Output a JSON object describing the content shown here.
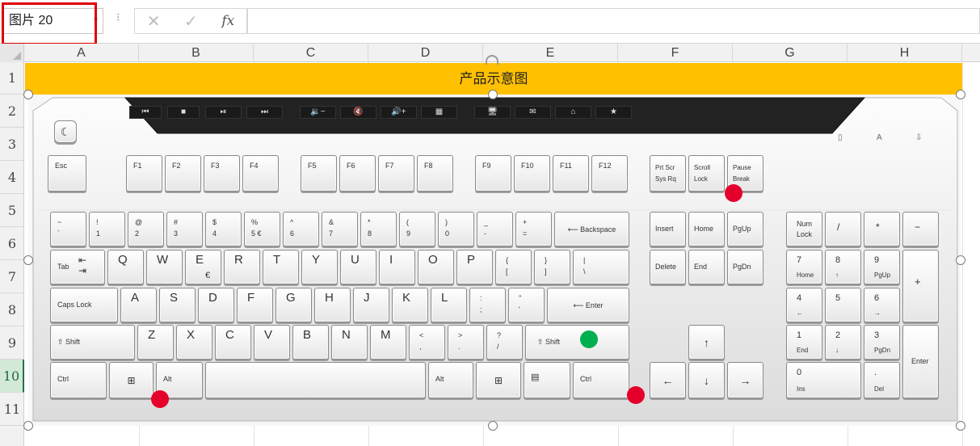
{
  "formula_bar": {
    "name_box": "图片 20",
    "name_box_dropdown": "▾",
    "separator": "⁝",
    "cancel_icon": "✕",
    "enter_icon": "✓",
    "fx": "fx",
    "formula": ""
  },
  "columns": [
    "A",
    "B",
    "C",
    "D",
    "E",
    "F",
    "G",
    "H"
  ],
  "rows": [
    "1",
    "2",
    "3",
    "4",
    "5",
    "6",
    "7",
    "8",
    "9",
    "10",
    "11"
  ],
  "selected_row": "10",
  "title_cell": "产品示意图",
  "picture": {
    "name": "keyboard-photo",
    "media_labels": [
      "⏮",
      "■",
      "⏯",
      "⏭",
      "🔉−",
      "🔇",
      "🔊+",
      "▦",
      "🖥",
      "✉",
      "⌂",
      "★"
    ],
    "function_row": [
      "Esc",
      "F1",
      "F2",
      "F3",
      "F4",
      "F5",
      "F6",
      "F7",
      "F8",
      "F9",
      "F10",
      "F11",
      "F12"
    ],
    "system_keys": [
      [
        "Prt Scr",
        "Sys Rq"
      ],
      [
        "Scroll",
        "Lock"
      ],
      [
        "Pause",
        "Break"
      ]
    ],
    "number_row": [
      [
        "~",
        "`"
      ],
      [
        "!",
        "1"
      ],
      [
        "@",
        "2"
      ],
      [
        "#",
        "3"
      ],
      [
        "$",
        "4"
      ],
      [
        "%",
        "5 €"
      ],
      [
        "^",
        "6"
      ],
      [
        "&",
        "7"
      ],
      [
        "*",
        "8"
      ],
      [
        "(",
        "9"
      ],
      [
        ")",
        "0"
      ],
      [
        "_",
        "-"
      ],
      [
        "+",
        "="
      ]
    ],
    "backspace": "⟵ Backspace",
    "tab": "Tab",
    "qwerty": [
      "Q",
      "W",
      "E",
      "R",
      "T",
      "Y",
      "U",
      "I",
      "O",
      "P"
    ],
    "brackets": [
      [
        "{",
        "["
      ],
      [
        "}",
        "]"
      ],
      [
        "|",
        "\\"
      ]
    ],
    "capslock": "Caps Lock",
    "asdf": [
      "A",
      "S",
      "D",
      "F",
      "G",
      "H",
      "J",
      "K",
      "L"
    ],
    "semis": [
      [
        ":",
        ";"
      ],
      [
        "\"",
        "'"
      ]
    ],
    "enter": "⟵ Enter",
    "shift": "⇧ Shift",
    "zxcv": [
      "Z",
      "X",
      "C",
      "V",
      "B",
      "N",
      "M"
    ],
    "punct": [
      [
        "<",
        ","
      ],
      [
        ">",
        "."
      ],
      [
        "?",
        "/"
      ]
    ],
    "ctrl": "Ctrl",
    "alt": "Alt",
    "nav_top": [
      "Insert",
      "Home",
      "PgUp"
    ],
    "nav_bottom": [
      "Delete",
      "End",
      "PgDn"
    ],
    "arrows": [
      "↑",
      "←",
      "↓",
      "→"
    ],
    "numlock": [
      "Num",
      "Lock"
    ],
    "numpad": {
      "div": "/",
      "mul": "*",
      "minus": "−",
      "plus": "+",
      "enter": "Enter",
      "keys": [
        [
          "7",
          "Home"
        ],
        [
          "8",
          "↑"
        ],
        [
          "9",
          "PgUp"
        ],
        [
          "4",
          "←"
        ],
        [
          "5",
          ""
        ],
        [
          "6",
          "→"
        ],
        [
          "1",
          "End"
        ],
        [
          "2",
          "↓"
        ],
        [
          "3",
          "PgDn"
        ],
        [
          "0",
          "Ins"
        ],
        [
          ".",
          "Del"
        ]
      ]
    },
    "indicators": [
      "▯",
      "A",
      "⇩"
    ],
    "markers": [
      {
        "color": "#e4002b"
      },
      {
        "color": "#e4002b"
      },
      {
        "color": "#e4002b"
      },
      {
        "color": "#00b050"
      }
    ]
  }
}
